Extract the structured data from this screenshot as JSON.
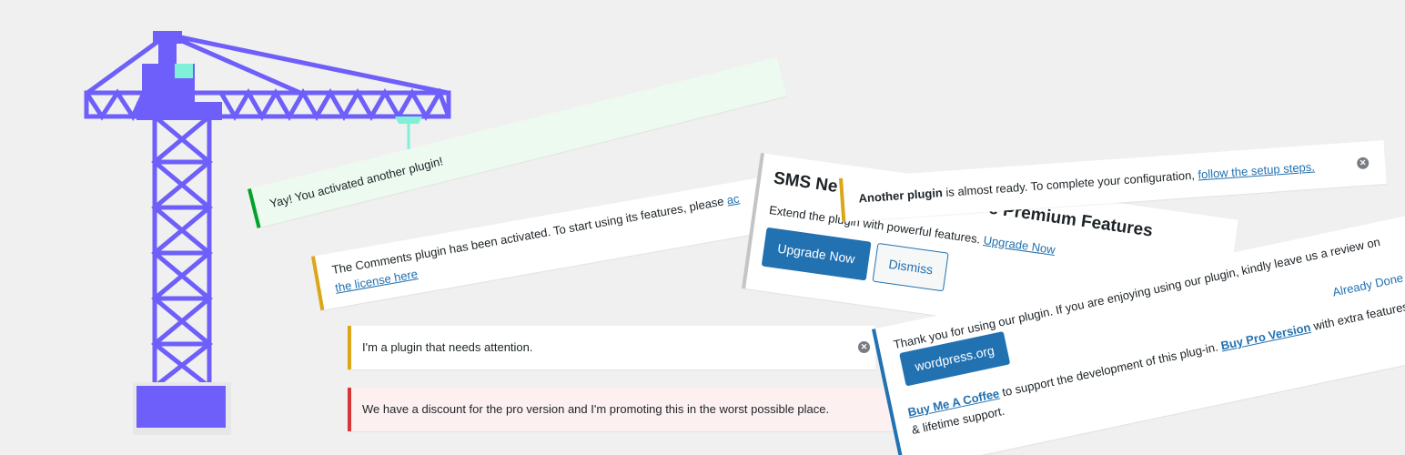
{
  "colors": {
    "crane": "#6e5ffb",
    "crane_accent": "#7ef1d8",
    "success": "#00a32a",
    "warning": "#dba617",
    "error": "#d63638",
    "info": "#2271b1"
  },
  "illustration": {
    "name": "crane-illustration"
  },
  "notices": {
    "yay": {
      "text": "Yay! You activated another plugin!"
    },
    "comments": {
      "text": "The Comments plugin has been activated. To start using its features, please ",
      "link_start": "ac",
      "link_end": "the license here"
    },
    "attention": {
      "text": "I'm a plugin that needs attention.",
      "dismiss_icon": "dismiss-icon"
    },
    "discount": {
      "text": "We have a discount for the pro version and I'm promoting this in the worst possible place."
    },
    "premium": {
      "title_start": "SMS Ne",
      "title_end": "e Premium Features",
      "description": "Extend the plugin with powerful features. ",
      "link": "Upgrade Now",
      "primary_button": "Upgrade Now",
      "secondary_button": "Dismiss"
    },
    "another": {
      "bold": "Another plugin",
      "text": " is almost ready. To complete your configuration, ",
      "link": "follow the setup steps.",
      "dismiss_icon": "dismiss-icon"
    },
    "thanks": {
      "text1": "Thank you for using our plugin. If you are enjoying using our plugin, kindly leave us a review on",
      "button": "wordpress.org",
      "link_coffee": "Buy Me A Coffee",
      "text2": " to support the development of this plug-in. ",
      "link_pro": "Buy Pro Version",
      "text3": " with extra features & lifetime support.",
      "already_done": "Already Done"
    }
  }
}
